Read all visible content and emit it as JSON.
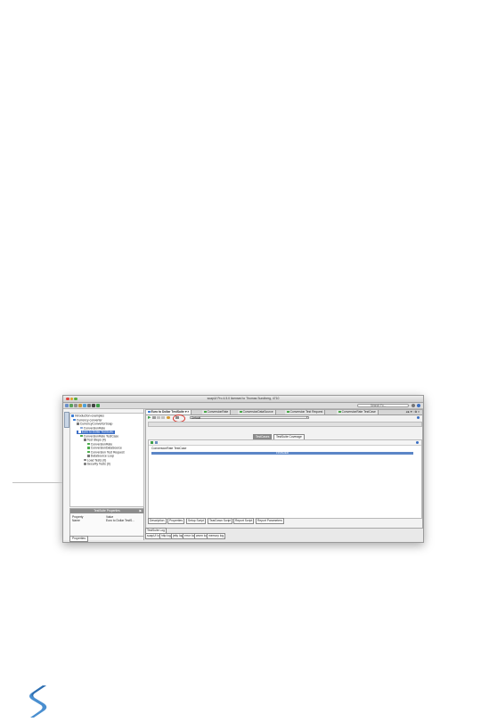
{
  "window": {
    "title": "soapUI Pro 4.5.0 licensed to Thomas Sundberg, 4710",
    "search_placeholder": "Search Fo..."
  },
  "navigator": {
    "side_tab": "Navigator",
    "items": [
      {
        "label": "Introduction examples",
        "color": "#3d7ed6"
      },
      {
        "label": "Currency converter",
        "color": "#3d7ed6"
      },
      {
        "label": "CurrencyConvertorSoap",
        "color": "#7a7a7a"
      },
      {
        "label": "ConversionRate",
        "color": "#8aa8d8"
      },
      {
        "label": "Euro to Dollar TestSuite",
        "color": "#3d7ed6"
      },
      {
        "label": "ConversionRate TestCase",
        "color": "#4aaa4a"
      },
      {
        "label": "Test Steps (4)",
        "color": "#777777"
      },
      {
        "label": "ConversionRate",
        "color": "#4aaa4a"
      },
      {
        "label": "ConversionDataSource",
        "color": "#4aaa4a"
      },
      {
        "label": "Conversion Test Request",
        "color": "#4aaa4a"
      },
      {
        "label": "DataSource Loop",
        "color": "#777777"
      },
      {
        "label": "Load Tests (0)",
        "color": "#777777"
      },
      {
        "label": "Security Tests (0)",
        "color": "#777777"
      }
    ]
  },
  "inspector": {
    "header": "TestSuite Properties",
    "col_property": "Property",
    "col_value": "Value",
    "row_name": "Name",
    "row_value": "Euro to Dollar TestS...",
    "tab": "Properties"
  },
  "editor": {
    "tabs": [
      {
        "label": "Euro to Dollar TestSuite",
        "active": true
      },
      {
        "label": "ConversionRate",
        "active": false
      },
      {
        "label": "ConversionDataSource",
        "active": false
      },
      {
        "label": "Conversion Test Request",
        "active": false
      },
      {
        "label": "ConversionRate TestCase",
        "active": false
      }
    ],
    "environment": "Default",
    "seg_testcases": "TestCases",
    "seg_coverage": "TestSuite Coverage",
    "testcase_label": "ConversionRate TestCase",
    "status": "FINISHED",
    "bottom_tabs": [
      "Description",
      "Properties",
      "Setup Script",
      "TearDown Script",
      "Report Script",
      "Report Parameters"
    ],
    "log_tab": "TestSuite Log",
    "log_tabs": [
      "soapUI log",
      "http log",
      "jetty log",
      "error log",
      "wsrm log",
      "memory log"
    ]
  },
  "colors": {
    "accent": "#3d6fc6",
    "highlight_circle": "#d9342b",
    "logo": "#4a8fd0"
  }
}
